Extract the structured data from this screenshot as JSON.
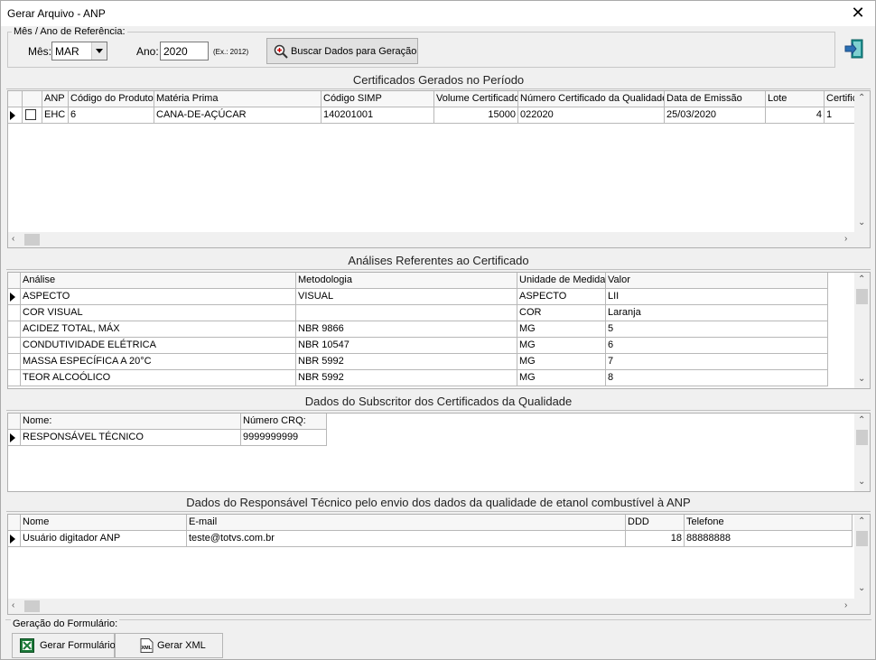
{
  "window": {
    "title": "Gerar Arquivo - ANP",
    "close_glyph": "✕"
  },
  "reference": {
    "group_label": "Mês / Ano de Referência:",
    "month_label": "Mês:",
    "month_value": "MAR",
    "year_label": "Ano:",
    "year_value": "2020",
    "year_hint": "(Ex.: 2012)",
    "search_button": "Buscar Dados para Geração"
  },
  "certificados": {
    "title": "Certificados Gerados no Período",
    "columns": [
      "ANP",
      "Código do Produto",
      "Matéria Prima",
      "Código SIMP",
      "Volume Certificado",
      "Número Certificado da Qualidade",
      "Data de Emissão",
      "Lote",
      "Certific"
    ],
    "rows": [
      [
        "EHC",
        "6",
        "CANA-DE-AÇÚCAR",
        "140201001",
        "15000",
        "022020",
        "25/03/2020",
        "4",
        "1"
      ]
    ]
  },
  "analises": {
    "title": "Análises Referentes ao Certificado",
    "columns": [
      "Análise",
      "Metodologia",
      "Unidade de Medida",
      "Valor"
    ],
    "rows": [
      [
        "ASPECTO",
        "VISUAL",
        "ASPECTO",
        "LII"
      ],
      [
        "COR VISUAL",
        "",
        "COR",
        "Laranja"
      ],
      [
        "ACIDEZ TOTAL, MÁX",
        "NBR 9866",
        "MG",
        "5"
      ],
      [
        "CONDUTIVIDADE ELÉTRICA",
        "NBR 10547",
        "MG",
        "6"
      ],
      [
        "MASSA ESPECÍFICA A 20°C",
        "NBR 5992",
        "MG",
        "7"
      ],
      [
        "TEOR ALCOÓLICO",
        "NBR 5992",
        "MG",
        "8"
      ]
    ]
  },
  "subscritor": {
    "title": "Dados do Subscritor dos Certificados da Qualidade",
    "columns": [
      "Nome:",
      "Número CRQ:"
    ],
    "rows": [
      [
        "RESPONSÁVEL TÉCNICO",
        "9999999999"
      ]
    ]
  },
  "responsavel": {
    "title": "Dados do Responsável Técnico pelo envio dos dados da qualidade de etanol combustível à ANP",
    "columns": [
      "Nome",
      "E-mail",
      "DDD",
      "Telefone"
    ],
    "rows": [
      [
        "Usuário digitador ANP",
        "teste@totvs.com.br",
        "18",
        "88888888"
      ]
    ]
  },
  "geracao": {
    "group_label": "Geração do Formulário:",
    "excel_button": "Gerar Formulário",
    "xml_button": "Gerar XML",
    "xml_icon_text": "XML"
  },
  "colors": {
    "excel_green": "#1d7a3a",
    "exit_teal": "#1b8c8c"
  }
}
